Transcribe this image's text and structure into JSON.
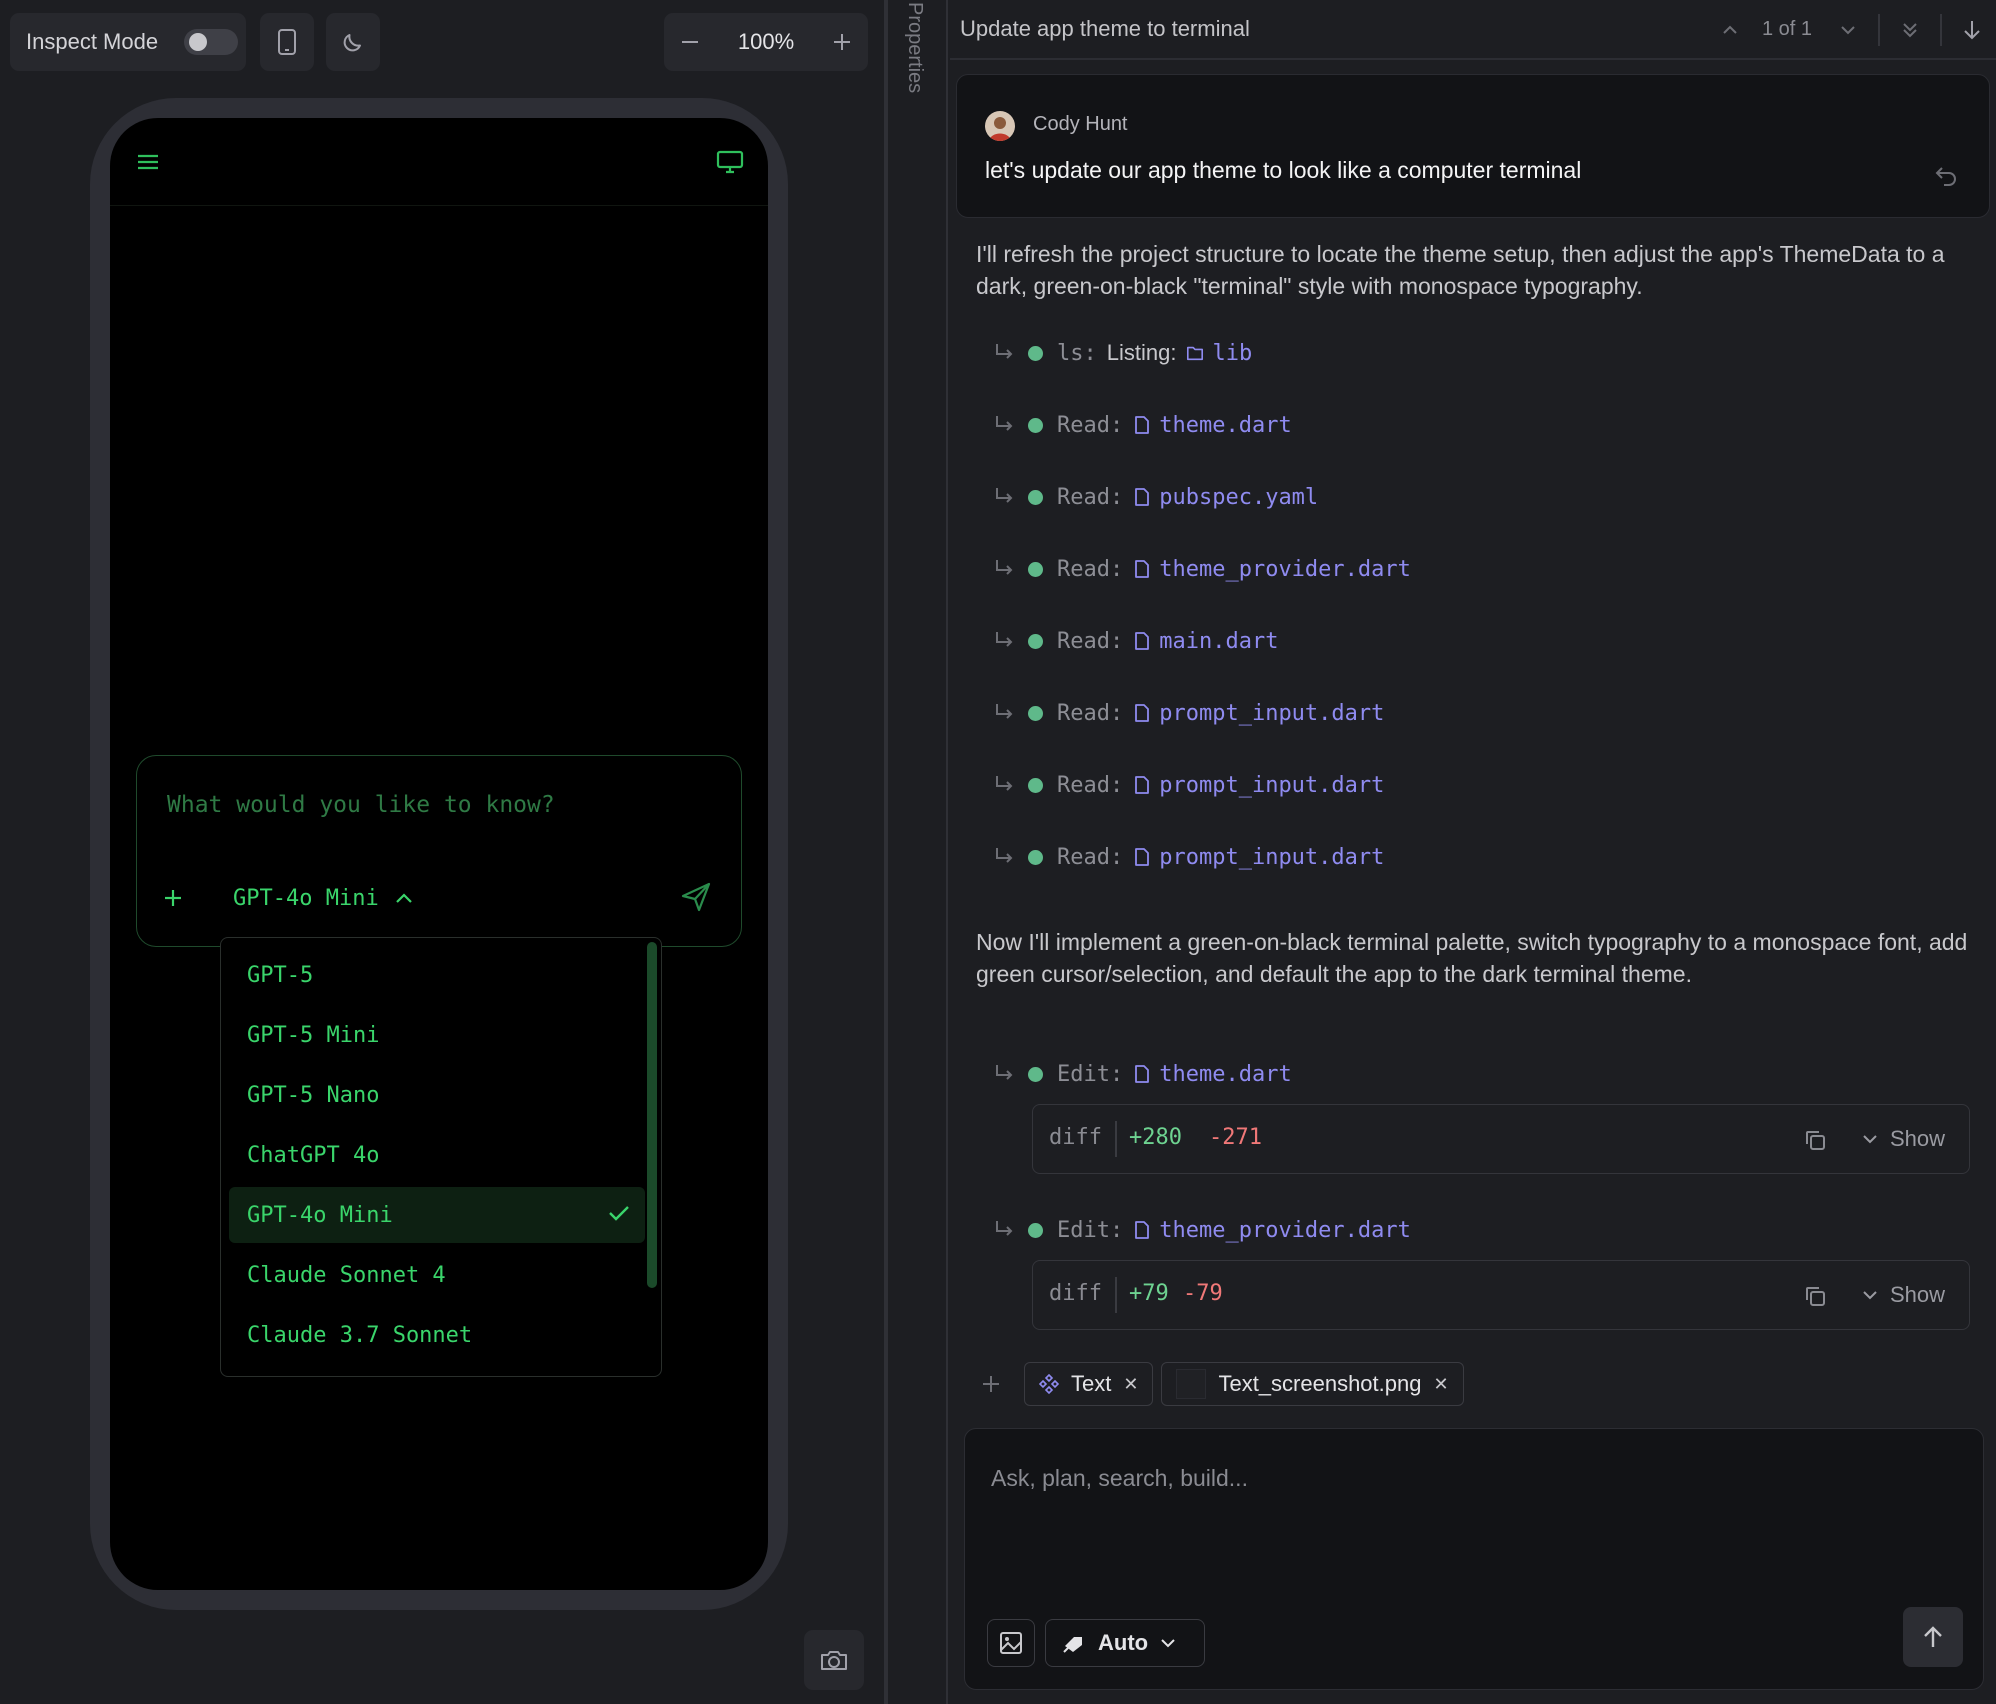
{
  "toolbar": {
    "inspect_label": "Inspect Mode",
    "inspect_enabled": false,
    "zoom_value": "100%"
  },
  "device_app": {
    "prompt_placeholder": "What would you like to know?",
    "selected_model": "GPT-4o Mini",
    "models": [
      {
        "label": "GPT-5",
        "selected": false
      },
      {
        "label": "GPT-5 Mini",
        "selected": false
      },
      {
        "label": "GPT-5 Nano",
        "selected": false
      },
      {
        "label": "ChatGPT 4o",
        "selected": false
      },
      {
        "label": "GPT-4o Mini",
        "selected": true
      },
      {
        "label": "Claude Sonnet 4",
        "selected": false
      },
      {
        "label": "Claude 3.7 Sonnet",
        "selected": false
      }
    ]
  },
  "properties_label": "Properties",
  "chat": {
    "title": "Update app theme to terminal",
    "match_count": "1 of 1",
    "user": {
      "name": "Cody Hunt",
      "message": "let's update our app theme to look like a computer terminal"
    },
    "intro": "I'll refresh the project structure to locate the theme setup, then adjust the app's ThemeData to a dark, green-on-black \"terminal\" style with monospace typography.",
    "tools": [
      {
        "name": "ls:",
        "sub": "Listing:",
        "file": "lib",
        "icon": "folder-icon"
      },
      {
        "name": "Read:",
        "file": "theme.dart",
        "icon": "file-icon"
      },
      {
        "name": "Read:",
        "file": "pubspec.yaml",
        "icon": "file-icon"
      },
      {
        "name": "Read:",
        "file": "theme_provider.dart",
        "icon": "file-icon"
      },
      {
        "name": "Read:",
        "file": "main.dart",
        "icon": "file-icon"
      },
      {
        "name": "Read:",
        "file": "prompt_input.dart",
        "icon": "file-icon"
      },
      {
        "name": "Read:",
        "file": "prompt_input.dart",
        "icon": "file-icon"
      },
      {
        "name": "Read:",
        "file": "prompt_input.dart",
        "icon": "file-icon"
      }
    ],
    "plan": "Now I'll implement a green-on-black terminal palette, switch typography to a monospace font, add green cursor/selection, and default the app to the dark terminal theme.",
    "edits": [
      {
        "name": "Edit:",
        "file": "theme.dart",
        "diff_label": "diff",
        "added": "+280",
        "removed": "-271",
        "show_label": "Show"
      },
      {
        "name": "Edit:",
        "file": "theme_provider.dart",
        "diff_label": "diff",
        "added": "+79",
        "removed": "-79",
        "show_label": "Show"
      }
    ],
    "attachments": [
      {
        "label": "Text",
        "icon": "component-icon"
      },
      {
        "label": "Text_screenshot.png",
        "icon": "image-thumbnail"
      }
    ],
    "composer_placeholder": "Ask, plan, search, build...",
    "mode_label": "Auto"
  },
  "colors": {
    "terminal_green": "#3ad56b",
    "status_dot": "#5fb98a",
    "file_link": "#8f8bf0",
    "diff_add": "#6ed391",
    "diff_remove": "#f07878"
  }
}
